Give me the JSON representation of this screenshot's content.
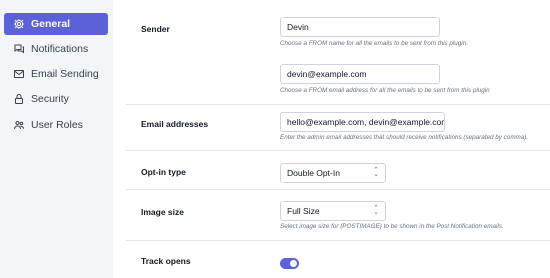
{
  "sidebar": {
    "items": [
      {
        "label": "General",
        "icon": "gear-icon",
        "active": true
      },
      {
        "label": "Notifications",
        "icon": "chat-bubbles-icon"
      },
      {
        "label": "Email Sending",
        "icon": "envelope-icon"
      },
      {
        "label": "Security",
        "icon": "lock-icon"
      },
      {
        "label": "User Roles",
        "icon": "users-icon"
      }
    ]
  },
  "settings": {
    "sender": {
      "label": "Sender",
      "name_value": "Devin",
      "name_help": "Choose a FROM name for all the emails to be sent from this plugin.",
      "email_value": "devin@example.com",
      "email_help": "Choose a FROM email address for all the emails to be sent from this plugin"
    },
    "email_addresses": {
      "label": "Email addresses",
      "value": "hello@example.com, devin@example.com",
      "help": "Enter the admin email addresses that should receive notifications (separated by comma)."
    },
    "optin": {
      "label": "Opt-in type",
      "value": "Double Opt-In"
    },
    "image_size": {
      "label": "Image size",
      "value": "Full Size",
      "help": "Select image size for {POSTIMAGE} to be shown in the Post Notification emails."
    },
    "track_opens": {
      "label": "Track opens",
      "enabled": true
    }
  },
  "colors": {
    "accent": "#5b61d6",
    "sidebar_bg": "#f4f5f7"
  }
}
